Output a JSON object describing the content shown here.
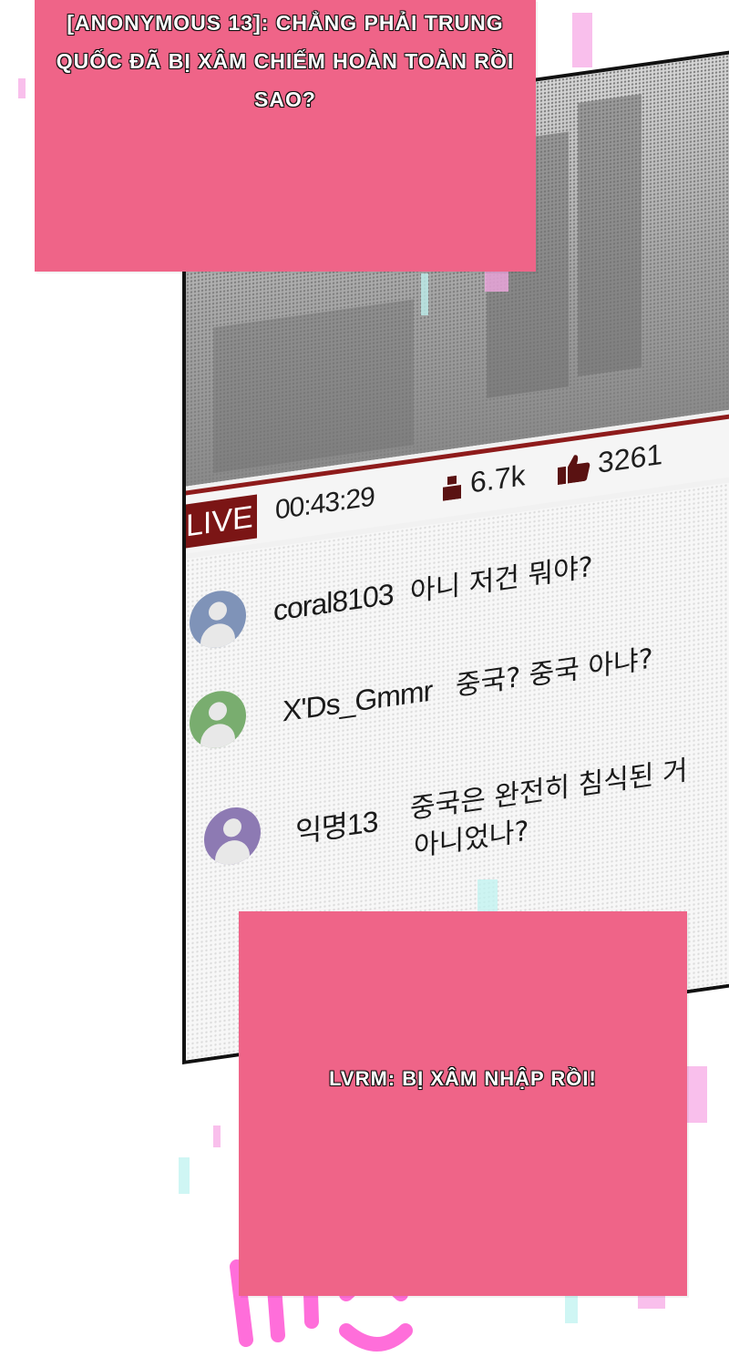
{
  "stream": {
    "live_label": "LIVE",
    "elapsed": "00:43:29",
    "viewers": "6.7k",
    "likes": "3261",
    "icons": {
      "viewer": "person-icon",
      "like": "thumbs-up-icon"
    }
  },
  "chat": [
    {
      "username": "coral8103",
      "message_lines": [
        "아니 저건 뭐야?"
      ],
      "avatar_color": "#7f93b8"
    },
    {
      "username": "X'Ds_Gmmr",
      "message_lines": [
        "중국? 중국 아냐?"
      ],
      "avatar_color": "#79ad6f"
    },
    {
      "username": "익명13",
      "message_lines": [
        "중국은 완전히 침식된 거",
        "아니었나?"
      ],
      "avatar_color": "#8d7ab3"
    }
  ],
  "captions": {
    "top": "[ANONYMOUS 13]: CHẲNG PHẢI TRUNG QUỐC ĐÃ BỊ XÂM CHIẾM HOÀN TOÀN RỒI SAO?",
    "bottom": "LVRM: BỊ XÂM NHẬP RỒI!"
  },
  "colors": {
    "caption_bg": "#ef6488",
    "live_badge": "#7b1515",
    "glitch_pink": "#f7a9e6",
    "glitch_cyan": "#bff3f0"
  }
}
